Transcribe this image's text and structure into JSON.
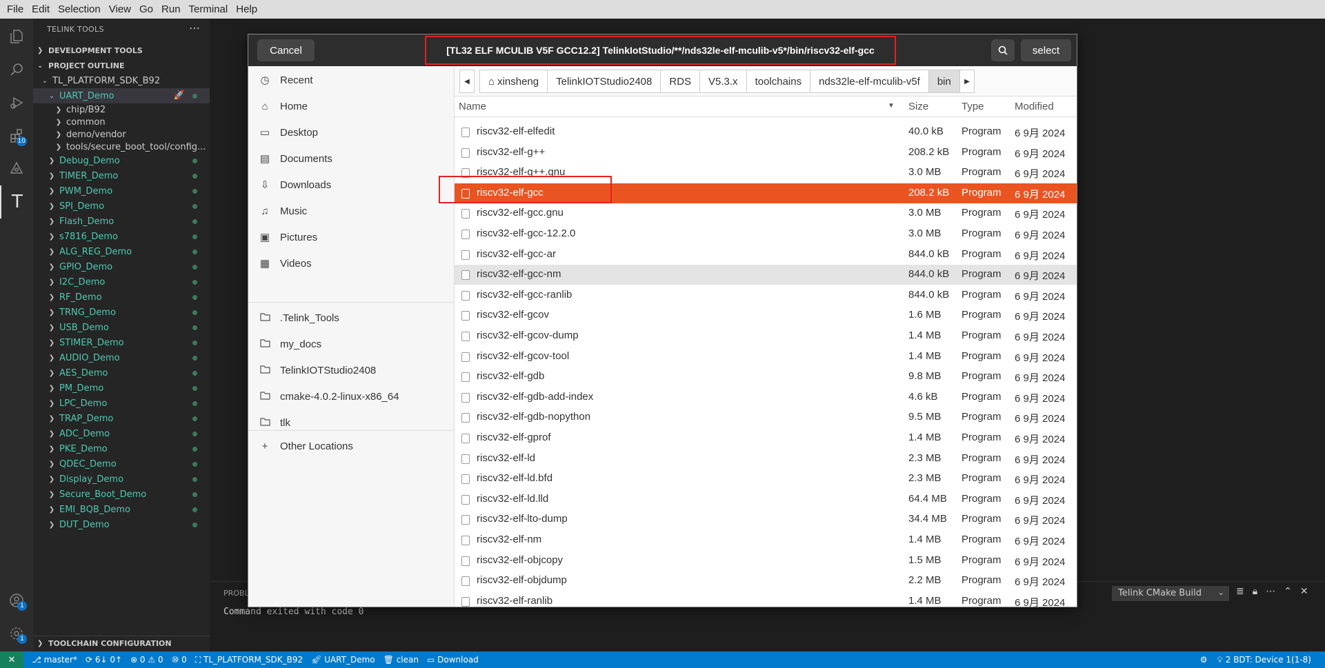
{
  "menubar": [
    "File",
    "Edit",
    "Selection",
    "View",
    "Go",
    "Run",
    "Terminal",
    "Help"
  ],
  "activity": {
    "explorer": "files-icon",
    "search": "search-icon",
    "debug": "run-debug-icon",
    "extensions": "extensions-icon",
    "extensions_badge": "10",
    "git": "source-control-icon",
    "telink": "T",
    "account": "account-icon",
    "account_badge": "1",
    "settings": "gear-icon",
    "settings_badge": "1"
  },
  "sidebar": {
    "title": "TELINK TOOLS",
    "dev_tools": "DEVELOPMENT TOOLS",
    "project_outline": "PROJECT OUTLINE",
    "sdk": "TL_PLATFORM_SDK_B92",
    "uart_demo": "UART_Demo",
    "uart_children": [
      "chip/B92",
      "common",
      "demo/vendor",
      "tools/secure_boot_tool/config..."
    ],
    "demos": [
      "Debug_Demo",
      "TIMER_Demo",
      "PWM_Demo",
      "SPI_Demo",
      "Flash_Demo",
      "s7816_Demo",
      "ALG_REG_Demo",
      "GPIO_Demo",
      "I2C_Demo",
      "RF_Demo",
      "TRNG_Demo",
      "USB_Demo",
      "STIMER_Demo",
      "AUDIO_Demo",
      "AES_Demo",
      "PM_Demo",
      "LPC_Demo",
      "TRAP_Demo",
      "ADC_Demo",
      "PKE_Demo",
      "QDEC_Demo",
      "Display_Demo",
      "Secure_Boot_Demo",
      "EMI_BQB_Demo",
      "DUT_Demo"
    ],
    "toolchain_config": "TOOLCHAIN CONFIGURATION"
  },
  "panel": {
    "title": "PROBL",
    "output": "Command exited with code 0",
    "task_select": "Telink CMake Build"
  },
  "statusbar": {
    "branch": "master*",
    "sync": "6↓ 0↑",
    "problems": "⊗ 0 ⚠ 0",
    "ports": "⑩ 0",
    "project": "TL_PLATFORM_SDK_B92",
    "target": "UART_Demo",
    "clean": "clean",
    "download": "Download",
    "device": "2 BDT: Device 1(1-8)"
  },
  "dialog": {
    "cancel_label": "Cancel",
    "title": "[TL32 ELF MCULIB V5F GCC12.2] TelinkIotStudio/**/nds32le-elf-mculib-v5*/bin/riscv32-elf-gcc",
    "select_label": "select",
    "places": [
      "Recent",
      "Home",
      "Desktop",
      "Documents",
      "Downloads",
      "Music",
      "Pictures",
      "Videos"
    ],
    "bookmarks": [
      ".Telink_Tools",
      "my_docs",
      "TelinkIOTStudio2408",
      "cmake-4.0.2-linux-x86_64",
      "tlk"
    ],
    "other_locations": "Other Locations",
    "crumbs": [
      "xinsheng",
      "TelinkIOTStudio2408",
      "RDS",
      "V5.3.x",
      "toolchains",
      "nds32le-elf-mculib-v5f",
      "bin"
    ],
    "columns": {
      "name": "Name",
      "size": "Size",
      "type": "Type",
      "modified": "Modified"
    },
    "files": [
      {
        "name": "riscv32-elf-elfedit",
        "size": "40.0 kB",
        "type": "Program",
        "modified": "6 9月 2024"
      },
      {
        "name": "riscv32-elf-g++",
        "size": "208.2 kB",
        "type": "Program",
        "modified": "6 9月 2024"
      },
      {
        "name": "riscv32-elf-g++.gnu",
        "size": "3.0 MB",
        "type": "Program",
        "modified": "6 9月 2024"
      },
      {
        "name": "riscv32-elf-gcc",
        "size": "208.2 kB",
        "type": "Program",
        "modified": "6 9月 2024"
      },
      {
        "name": "riscv32-elf-gcc.gnu",
        "size": "3.0 MB",
        "type": "Program",
        "modified": "6 9月 2024"
      },
      {
        "name": "riscv32-elf-gcc-12.2.0",
        "size": "3.0 MB",
        "type": "Program",
        "modified": "6 9月 2024"
      },
      {
        "name": "riscv32-elf-gcc-ar",
        "size": "844.0 kB",
        "type": "Program",
        "modified": "6 9月 2024"
      },
      {
        "name": "riscv32-elf-gcc-nm",
        "size": "844.0 kB",
        "type": "Program",
        "modified": "6 9月 2024"
      },
      {
        "name": "riscv32-elf-gcc-ranlib",
        "size": "844.0 kB",
        "type": "Program",
        "modified": "6 9月 2024"
      },
      {
        "name": "riscv32-elf-gcov",
        "size": "1.6 MB",
        "type": "Program",
        "modified": "6 9月 2024"
      },
      {
        "name": "riscv32-elf-gcov-dump",
        "size": "1.4 MB",
        "type": "Program",
        "modified": "6 9月 2024"
      },
      {
        "name": "riscv32-elf-gcov-tool",
        "size": "1.4 MB",
        "type": "Program",
        "modified": "6 9月 2024"
      },
      {
        "name": "riscv32-elf-gdb",
        "size": "9.8 MB",
        "type": "Program",
        "modified": "6 9月 2024"
      },
      {
        "name": "riscv32-elf-gdb-add-index",
        "size": "4.6 kB",
        "type": "Program",
        "modified": "6 9月 2024"
      },
      {
        "name": "riscv32-elf-gdb-nopython",
        "size": "9.5 MB",
        "type": "Program",
        "modified": "6 9月 2024"
      },
      {
        "name": "riscv32-elf-gprof",
        "size": "1.4 MB",
        "type": "Program",
        "modified": "6 9月 2024"
      },
      {
        "name": "riscv32-elf-ld",
        "size": "2.3 MB",
        "type": "Program",
        "modified": "6 9月 2024"
      },
      {
        "name": "riscv32-elf-ld.bfd",
        "size": "2.3 MB",
        "type": "Program",
        "modified": "6 9月 2024"
      },
      {
        "name": "riscv32-elf-ld.lld",
        "size": "64.4 MB",
        "type": "Program",
        "modified": "6 9月 2024"
      },
      {
        "name": "riscv32-elf-lto-dump",
        "size": "34.4 MB",
        "type": "Program",
        "modified": "6 9月 2024"
      },
      {
        "name": "riscv32-elf-nm",
        "size": "1.4 MB",
        "type": "Program",
        "modified": "6 9月 2024"
      },
      {
        "name": "riscv32-elf-objcopy",
        "size": "1.5 MB",
        "type": "Program",
        "modified": "6 9月 2024"
      },
      {
        "name": "riscv32-elf-objdump",
        "size": "2.2 MB",
        "type": "Program",
        "modified": "6 9月 2024"
      },
      {
        "name": "riscv32-elf-ranlib",
        "size": "1.4 MB",
        "type": "Program",
        "modified": "6 9月 2024"
      }
    ],
    "selected_file": "riscv32-elf-gcc",
    "hovered_file": "riscv32-elf-gcc-nm"
  },
  "colors": {
    "accent": "#e95420",
    "statusbar": "#007acc",
    "annotation": "#e52020"
  }
}
